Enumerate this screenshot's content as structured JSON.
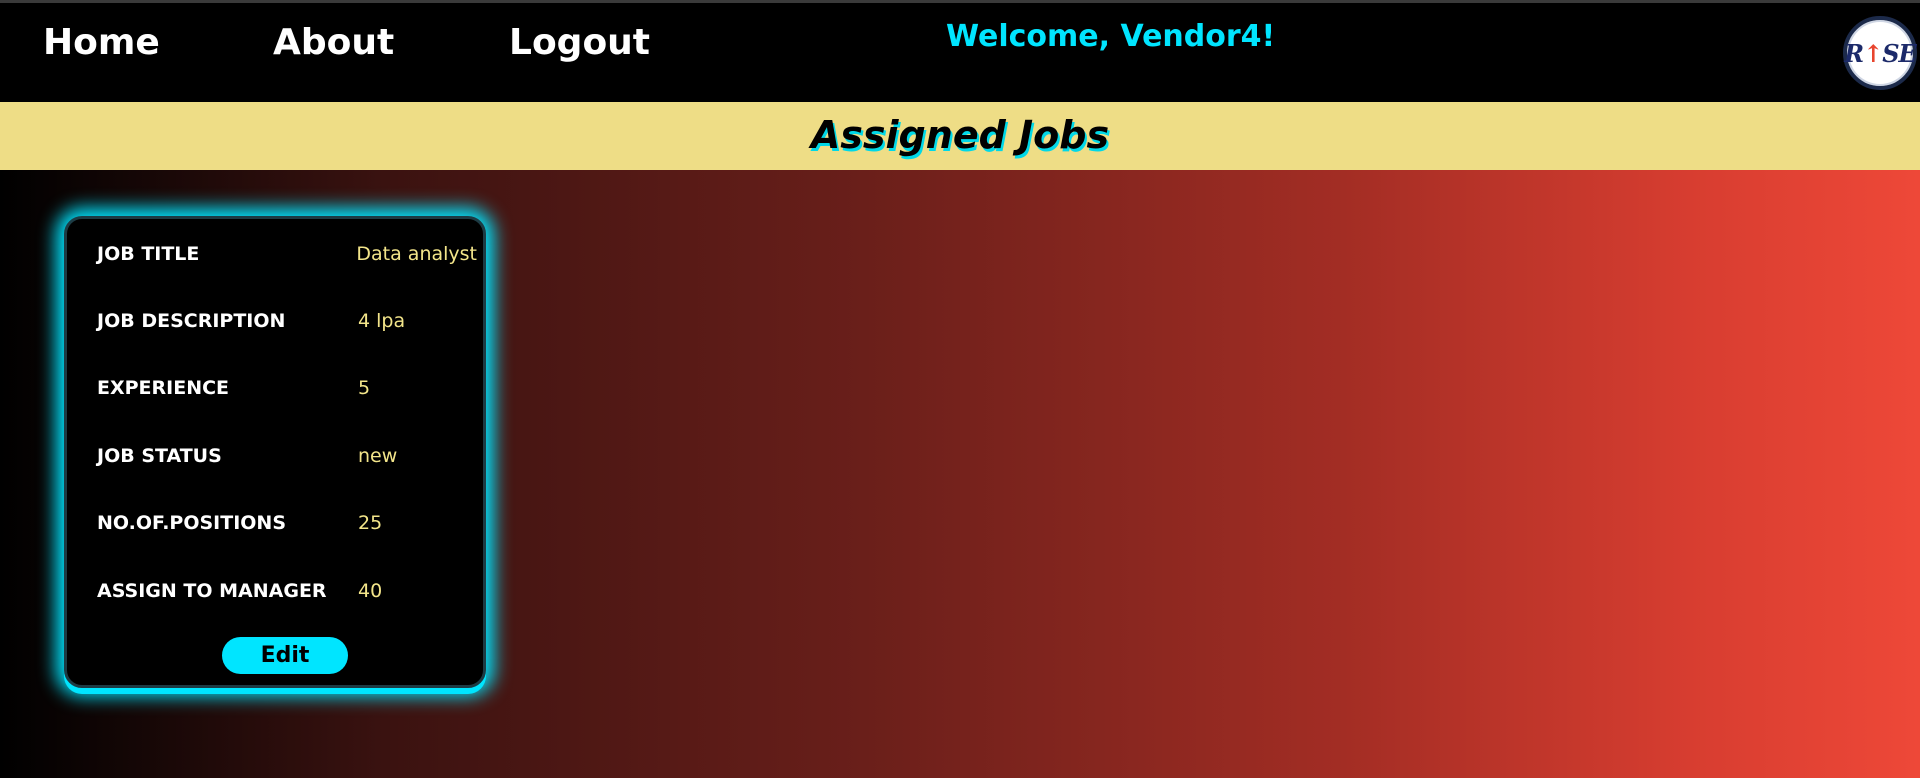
{
  "nav": {
    "home_label": "Home",
    "about_label": "About",
    "logout_label": "Logout",
    "welcome_text": "Welcome, Vendor4!"
  },
  "logo": {
    "text_left": "R",
    "arrow": "↑",
    "text_right": "SE"
  },
  "banner": {
    "title": "Assigned Jobs"
  },
  "job_card": {
    "fields": [
      {
        "label": "JOB TITLE",
        "value": "Data analyst"
      },
      {
        "label": "JOB DESCRIPTION",
        "value": "4 lpa"
      },
      {
        "label": "EXPERIENCE",
        "value": "5"
      },
      {
        "label": "JOB STATUS",
        "value": "new"
      },
      {
        "label": "NO.OF.POSITIONS",
        "value": "25"
      },
      {
        "label": "ASSIGN TO MANAGER",
        "value": "40"
      }
    ],
    "edit_label": "Edit"
  },
  "colors": {
    "accent": "#00e5ff",
    "banner_bg": "#eedd86",
    "value_text": "#f3e58a",
    "gradient_end": "#ee4838"
  }
}
